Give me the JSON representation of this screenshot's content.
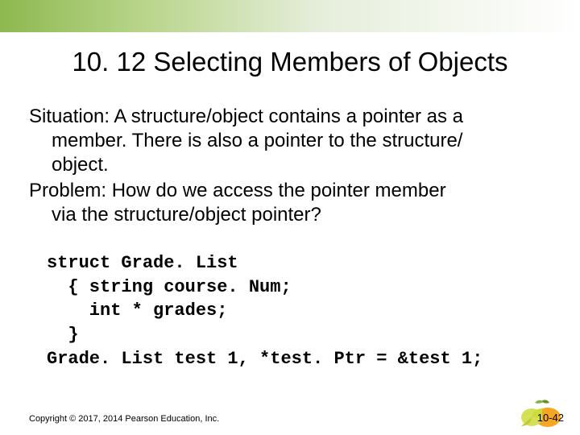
{
  "title": "10. 12 Selecting Members of Objects",
  "body": {
    "p1_line1": "Situation:  A structure/object contains a pointer as a",
    "p1_line2": "member.  There is also a pointer to the structure/",
    "p1_line3": "object.",
    "p2_line1": "Problem: How do we access the pointer member",
    "p2_line2": "via the structure/object pointer?"
  },
  "code": {
    "l1": "struct Grade. List",
    "l2": "  { string course. Num;",
    "l3": "    int * grades;",
    "l4": "  }",
    "l5": "Grade. List test 1, *test. Ptr = &test 1;"
  },
  "footer": {
    "copyright": "Copyright © 2017, 2014 Pearson Education, Inc.",
    "pagenum": "10-42"
  }
}
